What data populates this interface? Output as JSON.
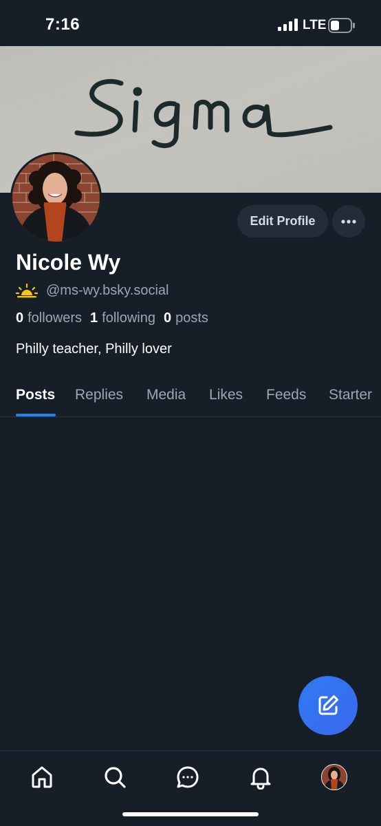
{
  "status_bar": {
    "time": "7:16",
    "network": "LTE",
    "icons": [
      "signal-icon",
      "battery-icon"
    ]
  },
  "banner": {
    "image": "handwritten-signature-banner",
    "handwritten_text": "Sigma"
  },
  "profile": {
    "display_name": "Nicole Wy",
    "handle": "@ms-wy.bsky.social",
    "handle_icon": "sun-icon",
    "bio": "Philly teacher, Philly lover",
    "stats": [
      {
        "count": "0",
        "label": "followers"
      },
      {
        "count": "1",
        "label": "following"
      },
      {
        "count": "0",
        "label": "posts"
      }
    ]
  },
  "actions": {
    "edit_profile_label": "Edit Profile",
    "more_icon": "more-horizontal-icon"
  },
  "tabs": [
    {
      "label": "Posts",
      "active": true
    },
    {
      "label": "Replies",
      "active": false
    },
    {
      "label": "Media",
      "active": false
    },
    {
      "label": "Likes",
      "active": false
    },
    {
      "label": "Feeds",
      "active": false
    },
    {
      "label": "Starter",
      "active": false
    }
  ],
  "compose": {
    "icon": "compose-icon"
  },
  "bottom_nav": [
    {
      "icon": "home-icon"
    },
    {
      "icon": "search-icon"
    },
    {
      "icon": "chat-icon"
    },
    {
      "icon": "bell-icon"
    },
    {
      "icon": "profile-avatar"
    }
  ],
  "colors": {
    "background": "#161e27",
    "accent": "#1e83f3",
    "muted_text": "#9aa7b5",
    "button_bg": "#222d39",
    "fab": "#2f7af2"
  }
}
